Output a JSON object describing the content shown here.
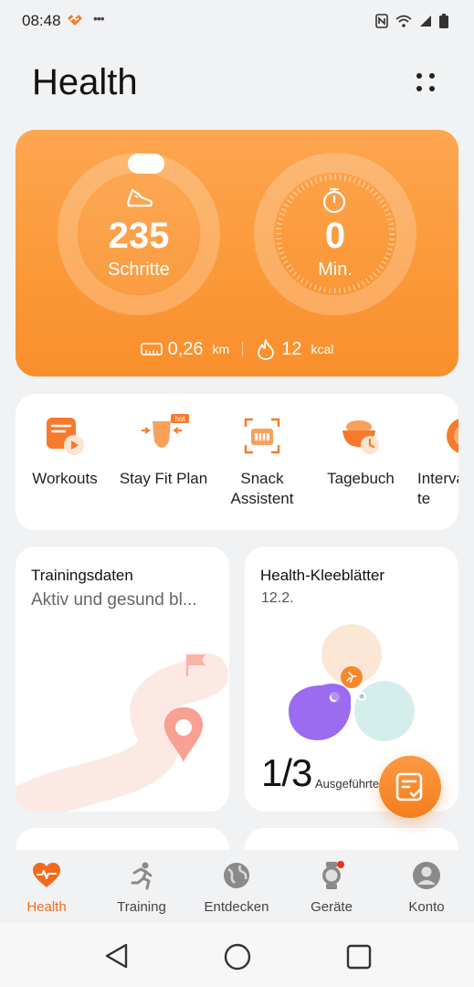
{
  "status_bar": {
    "time": "08:48",
    "dots": "•••"
  },
  "header": {
    "title": "Health"
  },
  "activity": {
    "steps_value": "235",
    "steps_label": "Schritte",
    "minutes_value": "0",
    "minutes_label": "Min.",
    "distance_value": "0,26",
    "distance_unit": "km",
    "calories_value": "12",
    "calories_unit": "kcal"
  },
  "quick_actions": [
    {
      "label": "Workouts",
      "icon": "workout-play-icon"
    },
    {
      "label": "Stay Fit Plan",
      "icon": "stay-fit-icon",
      "badge": "hot"
    },
    {
      "label": "Snack Assistent",
      "icon": "snack-scan-icon"
    },
    {
      "label": "Tagebuch",
      "icon": "diary-bowl-icon"
    },
    {
      "label": "Interva te",
      "icon": "interval-icon"
    }
  ],
  "training_card": {
    "title": "Trainingsdaten",
    "subtitle": "Aktiv und gesund bl..."
  },
  "clover_card": {
    "title": "Health-Kleeblätter",
    "date": "12.2.",
    "fraction": "1/3",
    "fraction_label": "Ausgeführte"
  },
  "bottom_nav": [
    {
      "label": "Health",
      "icon": "heart-icon",
      "active": true
    },
    {
      "label": "Training",
      "icon": "runner-icon",
      "active": false
    },
    {
      "label": "Entdecken",
      "icon": "globe-icon",
      "active": false
    },
    {
      "label": "Geräte",
      "icon": "watch-icon",
      "active": false
    },
    {
      "label": "Konto",
      "icon": "account-icon",
      "active": false
    }
  ],
  "colors": {
    "accent": "#f98f2c",
    "active_nav": "#f26b1d"
  }
}
